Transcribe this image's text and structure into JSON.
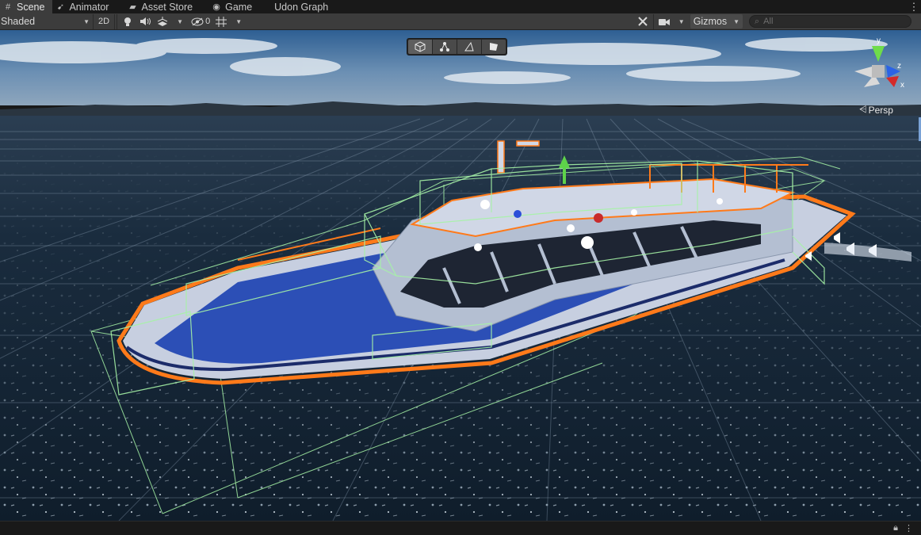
{
  "tabs": [
    {
      "label": "Scene",
      "icon": "grid-icon"
    },
    {
      "label": "Animator",
      "icon": "animator-icon"
    },
    {
      "label": "Asset Store",
      "icon": "store-icon"
    },
    {
      "label": "Game",
      "icon": "gamepad-icon"
    },
    {
      "label": "Udon Graph",
      "icon": ""
    }
  ],
  "active_tab": "Scene",
  "toolbar": {
    "draw_mode": "Shaded",
    "mode_2d": "2D",
    "hidden_count": "0",
    "gizmos_label": "Gizmos",
    "search_placeholder": "All"
  },
  "scene_tools": [
    "cube-icon",
    "node-graph-icon",
    "cone-icon",
    "flag-icon"
  ],
  "gizmo": {
    "projection_label": "Persp",
    "axis_y": "y",
    "axis_z": "z",
    "axis_x": "x"
  },
  "colors": {
    "selection_outline": "#ff7a1a",
    "collider_wire": "#9cf29c",
    "hull_blue": "#2c4fb6",
    "sea": "#132434"
  }
}
